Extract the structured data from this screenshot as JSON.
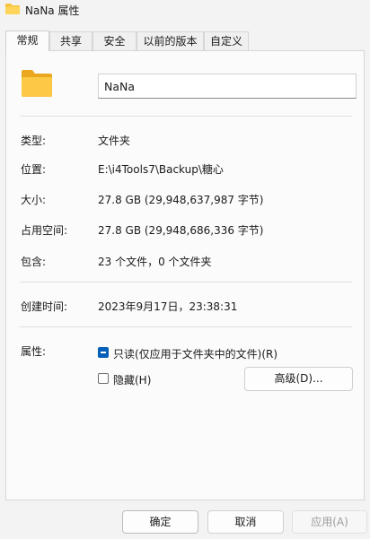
{
  "window": {
    "title": "NaNa 属性",
    "icon": "folder-icon"
  },
  "tabs": [
    {
      "label": "常规",
      "active": true
    },
    {
      "label": "共享",
      "active": false
    },
    {
      "label": "安全",
      "active": false
    },
    {
      "label": "以前的版本",
      "active": false
    },
    {
      "label": "自定义",
      "active": false
    }
  ],
  "general": {
    "folder_name": "NaNa",
    "rows": [
      {
        "label": "类型:",
        "value": "文件夹"
      },
      {
        "label": "位置:",
        "value": "E:\\i4Tools7\\Backup\\糖心"
      },
      {
        "label": "大小:",
        "value": "27.8 GB (29,948,637,987 字节)"
      },
      {
        "label": "占用空间:",
        "value": "27.8 GB (29,948,686,336 字节)"
      },
      {
        "label": "包含:",
        "value": "23 个文件，0 个文件夹"
      },
      {
        "label": "创建时间:",
        "value": "2023年9月17日，23:38:31"
      }
    ],
    "attributes": {
      "label": "属性:",
      "readonly": {
        "label": "只读(仅应用于文件夹中的文件)(R)",
        "checked": true
      },
      "hidden": {
        "label": "隐藏(H)",
        "checked": false
      },
      "advanced_button": "高级(D)..."
    }
  },
  "buttons": {
    "ok": "确定",
    "cancel": "取消",
    "apply": "应用(A)"
  },
  "colors": {
    "folder": "#f8c33c",
    "accent": "#005fb8"
  }
}
